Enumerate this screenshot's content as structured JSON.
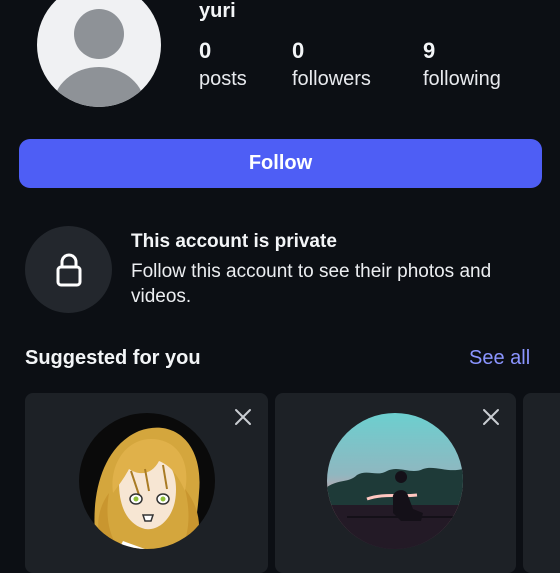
{
  "profile": {
    "username": "yuri",
    "stats": [
      {
        "value": "0",
        "label": "posts"
      },
      {
        "value": "0",
        "label": "followers"
      },
      {
        "value": "9",
        "label": "following"
      }
    ]
  },
  "follow_button": {
    "label": "Follow",
    "color": "#4e5ef5"
  },
  "private": {
    "title": "This account is private",
    "description": "Follow this account to see their photos and videos."
  },
  "suggested": {
    "title": "Suggested for you",
    "see_all": "See all",
    "cards": [
      {
        "avatar": "anime-girl-avatar",
        "close_icon": "close-icon"
      },
      {
        "avatar": "sunset-silhouette-avatar",
        "close_icon": "close-icon"
      }
    ]
  },
  "colors": {
    "background": "#0c0f14",
    "accent_link": "#8b95ff",
    "card": "#1d2126"
  }
}
